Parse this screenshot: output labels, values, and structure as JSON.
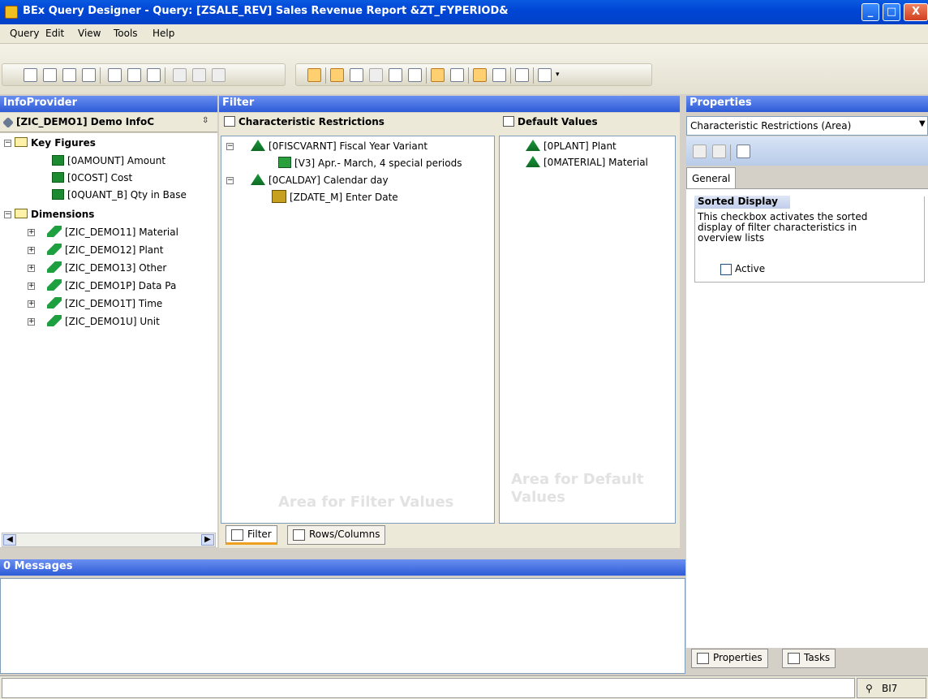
{
  "window": {
    "title": "BEx Query Designer - Query: [ZSALE_REV] Sales Revenue Report &ZT_FYPERIOD&",
    "minimize": "_",
    "maximize": "□",
    "close": "X"
  },
  "menu": [
    "Query",
    "Edit",
    "View",
    "Tools",
    "Help"
  ],
  "infoprovider": {
    "header": "InfoProvider",
    "root": "[ZIC_DEMO1] Demo InfoC",
    "key_figures_label": "Key Figures",
    "key_figures": [
      "[0AMOUNT] Amount",
      "[0COST] Cost",
      "[0QUANT_B] Qty in Base"
    ],
    "dimensions_label": "Dimensions",
    "dimensions": [
      "[ZIC_DEMO11] Material",
      "[ZIC_DEMO12] Plant",
      "[ZIC_DEMO13] Other",
      "[ZIC_DEMO1P] Data Pa",
      "[ZIC_DEMO1T] Time",
      "[ZIC_DEMO1U] Unit"
    ]
  },
  "filter": {
    "header": "Filter",
    "char_restrictions_label": "Characteristic Restrictions",
    "default_values_label": "Default Values",
    "char_items": [
      {
        "label": "[0FISCVARNT] Fiscal Year Variant",
        "child": "[V3] Apr.- March, 4 special periods"
      },
      {
        "label": "[0CALDAY] Calendar day",
        "child": "[ZDATE_M] Enter Date"
      }
    ],
    "default_items": [
      "[0PLANT] Plant",
      "[0MATERIAL] Material"
    ],
    "area_filter": "Area for Filter Values",
    "area_default_1": "Area for Default",
    "area_default_2": "Values",
    "tab_filter": "Filter",
    "tab_rows": "Rows/Columns"
  },
  "messages": {
    "header": "0 Messages"
  },
  "properties": {
    "header": "Properties",
    "dropdown_value": "Characteristic Restrictions (Area)",
    "tab_general": "General",
    "group_title": "Sorted Display",
    "description": "This checkbox activates the sorted display of filter characteristics in overview lists",
    "checkbox_label": "Active",
    "checkbox_checked": false,
    "tab_properties": "Properties",
    "tab_tasks": "Tasks"
  },
  "status": {
    "system": "BI7"
  }
}
